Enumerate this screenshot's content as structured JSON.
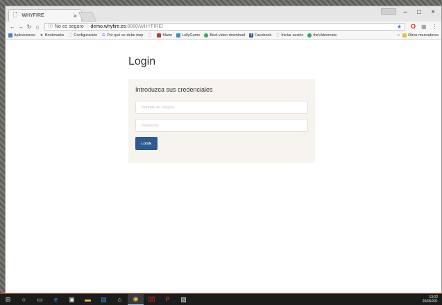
{
  "browser": {
    "tab_title": "WHYFIRE",
    "tab_close": "×",
    "window_controls": {
      "minimize": "–",
      "maximize": "□",
      "close": "×"
    },
    "address": {
      "security_label": "No es seguro",
      "host": "demo.whyfire.es",
      "path": ":8080/WHYFIRE/"
    },
    "bookmarks": [
      {
        "label": "Aplicaciones",
        "icon": "apps-icon",
        "color": "#4a7bd0"
      },
      {
        "label": "Bookmarks",
        "icon": "star-icon",
        "color": "#333333"
      },
      {
        "label": "Configuración",
        "icon": "page-icon",
        "color": "#888888"
      },
      {
        "label": "Por qué se debe insp",
        "icon": "google-icon",
        "color": "#4285f4"
      },
      {
        "label": "",
        "icon": "page-icon",
        "color": "#888888"
      },
      {
        "label": "Mario",
        "icon": "mario-icon",
        "color": "#c0392b"
      },
      {
        "label": "LollyGame",
        "icon": "lolly-icon",
        "color": "#3b8fd9"
      },
      {
        "label": "Best video download",
        "icon": "video-icon",
        "color": "#27ae60"
      },
      {
        "label": "Facebook",
        "icon": "facebook-icon",
        "color": "#3b5998"
      },
      {
        "label": "Iniciar sesión",
        "icon": "page-icon",
        "color": "#888888"
      },
      {
        "label": "theVideomate",
        "icon": "videomate-icon",
        "color": "#27ae60"
      }
    ],
    "bookmarks_more": "»",
    "other_bookmarks": "Otros marcadores"
  },
  "page": {
    "heading": "Login",
    "card_title": "Introduzca sus credenciales",
    "username_placeholder": "Nombre de Usuario",
    "password_placeholder": "Password",
    "login_button": "LOGIN"
  },
  "taskbar": {
    "time": "13:02",
    "date": "20/06/201"
  }
}
